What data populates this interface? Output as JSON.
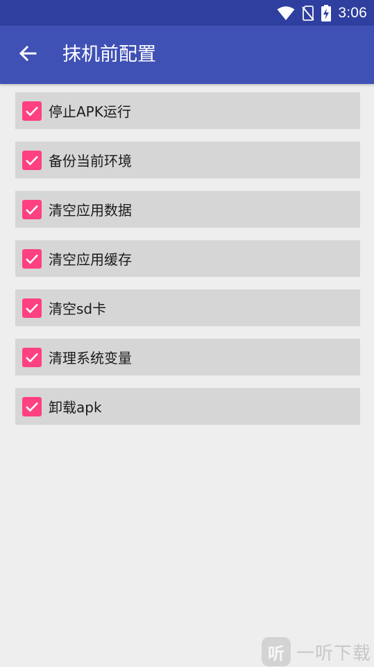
{
  "status_bar": {
    "time": "3:06",
    "icons": [
      "wifi-icon",
      "no-sim-icon",
      "battery-charging-icon"
    ]
  },
  "app_bar": {
    "back_icon": "arrow-back-icon",
    "title": "抹机前配置"
  },
  "options": [
    {
      "label": "停止APK运行",
      "checked": true
    },
    {
      "label": "备份当前环境",
      "checked": true
    },
    {
      "label": "清空应用数据",
      "checked": true
    },
    {
      "label": "清空应用缓存",
      "checked": true
    },
    {
      "label": "清空sd卡",
      "checked": true
    },
    {
      "label": "清理系统变量",
      "checked": true
    },
    {
      "label": "卸载apk",
      "checked": true
    }
  ],
  "watermark": {
    "logo_text": "听",
    "text": "一听下载"
  },
  "colors": {
    "status_bar": "#2f3f9f",
    "app_bar": "#3f51b5",
    "background": "#eeeeee",
    "row_background": "#d6d6d6",
    "checkbox_accent": "#ff4081"
  }
}
